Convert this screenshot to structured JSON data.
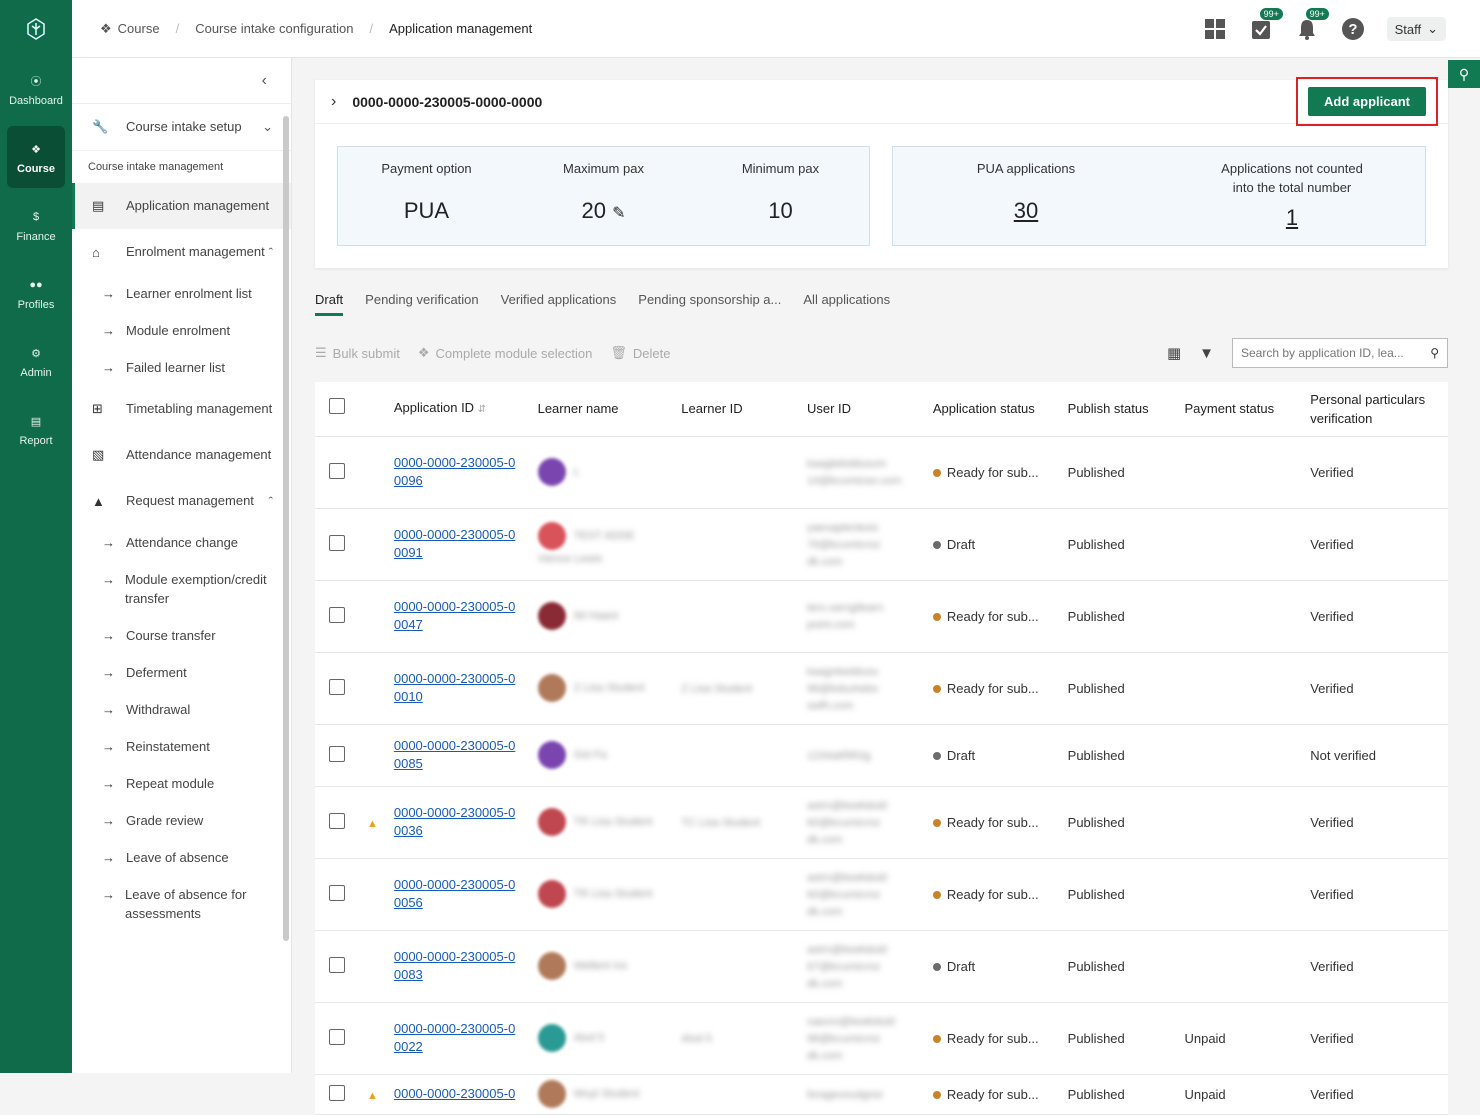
{
  "rail": {
    "items": [
      {
        "label": "Dashboard",
        "icon": "compass-icon"
      },
      {
        "label": "Course",
        "icon": "course-icon",
        "active": true
      },
      {
        "label": "Finance",
        "icon": "dollar-icon"
      },
      {
        "label": "Profiles",
        "icon": "people-icon"
      },
      {
        "label": "Admin",
        "icon": "admin-icon"
      },
      {
        "label": "Report",
        "icon": "chart-icon"
      }
    ]
  },
  "breadcrumb": {
    "items": [
      "Course",
      "Course intake configuration",
      "Application management"
    ]
  },
  "topbar": {
    "tasks_badge": "99+",
    "notif_badge": "99+",
    "user_label": "Staff"
  },
  "sidebar": {
    "course_intake_setup": "Course intake setup",
    "caption": "Course intake management",
    "application_management": "Application management",
    "enrolment_management": "Enrolment management",
    "enrolment_sub": [
      "Learner enrolment list",
      "Module enrolment",
      "Failed learner list"
    ],
    "timetabling_management": "Timetabling management",
    "attendance_management": "Attendance management",
    "request_management": "Request management",
    "request_sub": [
      "Attendance change",
      "Module exemption/credit transfer",
      "Course transfer",
      "Deferment",
      "Withdrawal",
      "Reinstatement",
      "Repeat module",
      "Grade review",
      "Leave of absence",
      "Leave of absence for assessments"
    ]
  },
  "intake": {
    "id": "0000-0000-230005-0000-0000",
    "add_button": "Add applicant",
    "payment_option_label": "Payment option",
    "payment_option_value": "PUA",
    "max_pax_label": "Maximum pax",
    "max_pax_value": "20",
    "min_pax_label": "Minimum pax",
    "min_pax_value": "10",
    "pua_label": "PUA applications",
    "pua_value": "30",
    "not_counted_label": "Applications not counted into the total number",
    "not_counted_value": "1"
  },
  "tabs": [
    "Draft",
    "Pending verification",
    "Verified applications",
    "Pending sponsorship a...",
    "All applications"
  ],
  "toolbar": {
    "bulk_submit": "Bulk submit",
    "complete_module": "Complete module selection",
    "delete": "Delete",
    "search_placeholder": "Search by application ID, lea..."
  },
  "table": {
    "headers": [
      "Application ID",
      "Learner name",
      "Learner ID",
      "User ID",
      "Application status",
      "Publish status",
      "Payment status",
      "Personal particulars verification"
    ],
    "rows": [
      {
        "id1": "0000-0000-230005-0",
        "id2": "0096",
        "name": "L",
        "lid": "",
        "uid": "kaaglekiddusum 14@kcumtceo.com",
        "status": "Ready for sub...",
        "status_color": "#c9822a",
        "publish": "Published",
        "payment": "",
        "verify": "Verified",
        "avatar": "#7b45b0",
        "warn": false
      },
      {
        "id1": "0000-0000-230005-0",
        "id2": "0091",
        "name": "TEST ADDE Vience Lewis",
        "lid": "",
        "uid": "yaexaplenlexic 76@kcumtcroz dk.com",
        "status": "Draft",
        "status_color": "#6c6c6c",
        "publish": "Published",
        "payment": "",
        "verify": "Verified",
        "avatar": "#d9535b",
        "warn": false
      },
      {
        "id1": "0000-0000-230005-0",
        "id2": "0047",
        "name": "IM Haant",
        "lid": "",
        "uid": "ters.varngtlearn point.com",
        "status": "Ready for sub...",
        "status_color": "#c9822a",
        "publish": "Published",
        "payment": "",
        "verify": "Verified",
        "avatar": "#8a2a35",
        "warn": false
      },
      {
        "id1": "0000-0000-230005-0",
        "id2": "0010",
        "name": "Z Lisa Student",
        "lid": "Z Lisa Student",
        "uid": "kaagnkeddusu 96@kdsuhebo swfh.com",
        "status": "Ready for sub...",
        "status_color": "#c9822a",
        "publish": "Published",
        "payment": "",
        "verify": "Verified",
        "avatar": "#b07a5a",
        "warn": false
      },
      {
        "id1": "0000-0000-230005-0",
        "id2": "0085",
        "name": "Gst Fa",
        "lid": "",
        "uid": "1234a6f9f1lg",
        "status": "Draft",
        "status_color": "#6c6c6c",
        "publish": "Published",
        "payment": "",
        "verify": "Not verified",
        "avatar": "#7b45b0",
        "warn": false
      },
      {
        "id1": "0000-0000-230005-0",
        "id2": "0036",
        "name": "TR Lisa Student",
        "lid": "TC Lisa Student",
        "uid": "astrn@lewkidukl 60@kcumtcroz dk.com",
        "status": "Ready for sub...",
        "status_color": "#c9822a",
        "publish": "Published",
        "payment": "",
        "verify": "Verified",
        "avatar": "#c0474f",
        "warn": true
      },
      {
        "id1": "0000-0000-230005-0",
        "id2": "0056",
        "name": "TR Lisa Student",
        "lid": "",
        "uid": "astrn@lewkidukl 60@kcumtcroz dk.com",
        "status": "Ready for sub...",
        "status_color": "#c9822a",
        "publish": "Published",
        "payment": "",
        "verify": "Verified",
        "avatar": "#c0474f",
        "warn": false
      },
      {
        "id1": "0000-0000-230005-0",
        "id2": "0083",
        "name": "Wellent Ivs",
        "lid": "",
        "uid": "astrn@lewkidukl 67@kcumtcroz dk.com",
        "status": "Draft",
        "status_color": "#6c6c6c",
        "publish": "Published",
        "payment": "",
        "verify": "Verified",
        "avatar": "#b07a5a",
        "warn": false
      },
      {
        "id1": "0000-0000-230005-0",
        "id2": "0022",
        "name": "Alvd 5",
        "lid": "Alvd 5",
        "uid": "xaexm@lewkidukl 98@kcumtcroz dk.com",
        "status": "Ready for sub...",
        "status_color": "#c9822a",
        "publish": "Published",
        "payment": "Unpaid",
        "verify": "Verified",
        "avatar": "#2a9a94",
        "warn": false
      },
      {
        "id1": "0000-0000-230005-0",
        "id2": "",
        "name": "Wuyt Student",
        "lid": "",
        "uid": "foragevoudgnsr",
        "status": "Ready for sub...",
        "status_color": "#c9822a",
        "publish": "Published",
        "payment": "Unpaid",
        "verify": "Verified",
        "avatar": "#b07a5a",
        "warn": true
      }
    ]
  },
  "colors": {
    "brand": "#127a52",
    "rail": "#0f6b4a",
    "highlight": "#d8232a",
    "link": "#1a5ab8"
  }
}
